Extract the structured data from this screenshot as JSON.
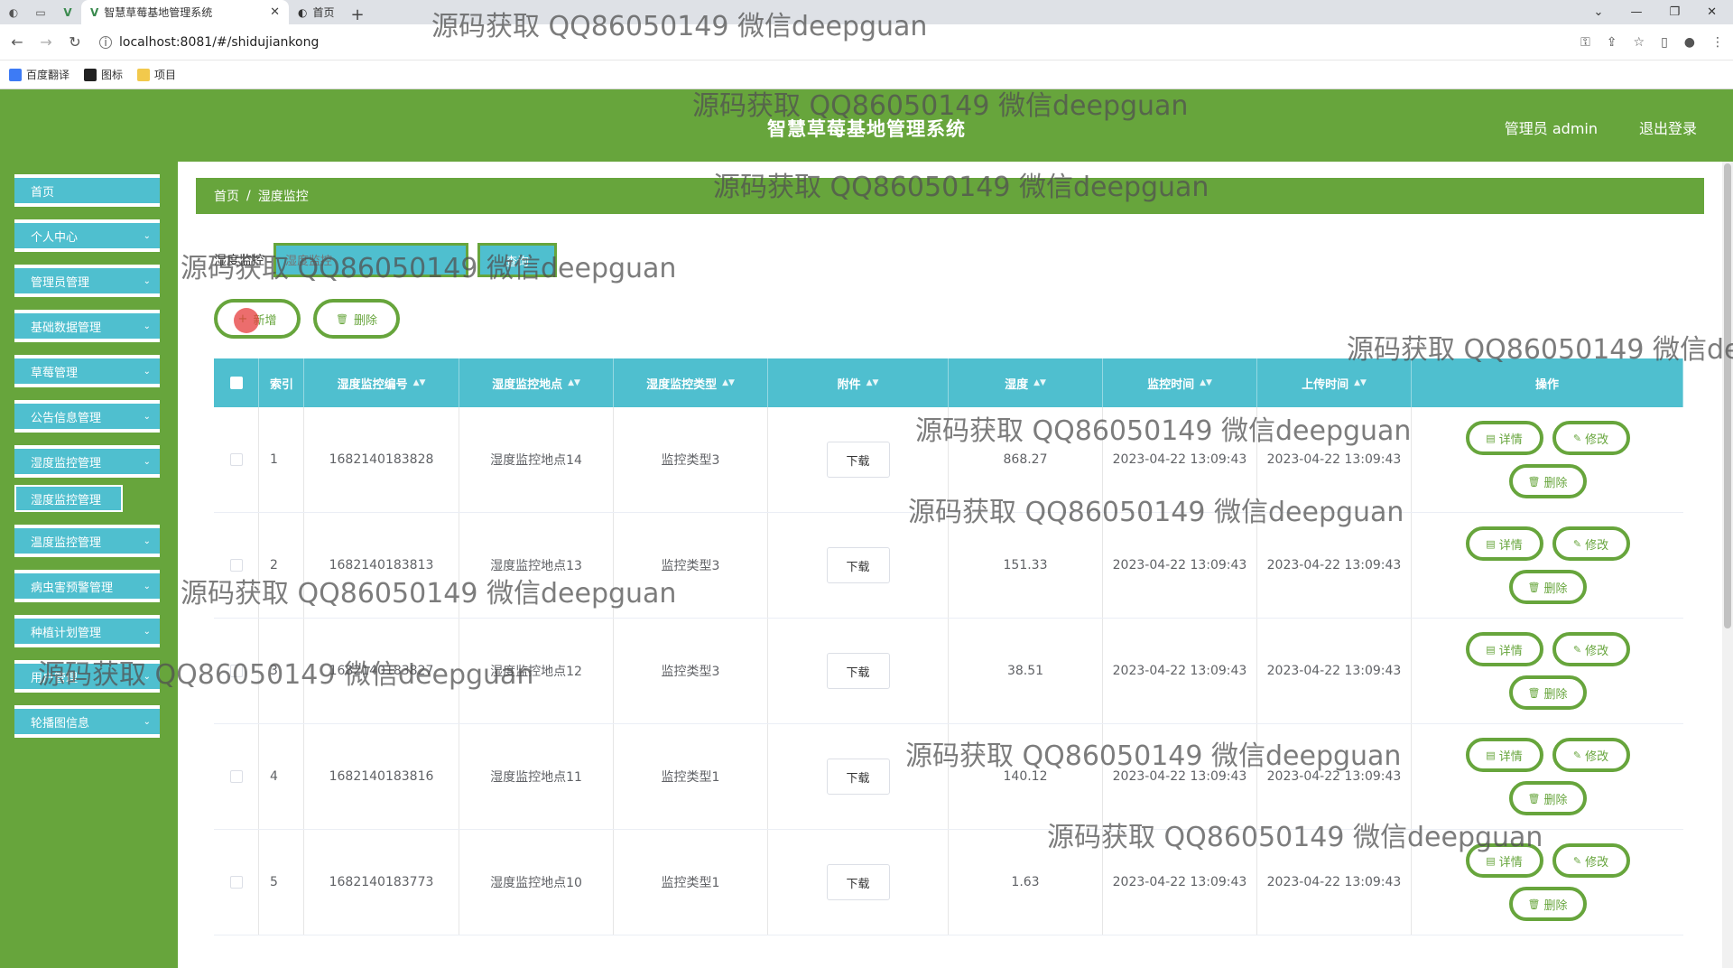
{
  "browser": {
    "active_tab_title": "智慧草莓基地管理系统",
    "second_tab_title": "首页",
    "url": "localhost:8081/#/shidujiankong",
    "bookmarks": [
      "百度翻译",
      "图标",
      "项目"
    ]
  },
  "app": {
    "title": "智慧草莓基地管理系统",
    "user_label": "管理员 admin",
    "logout_label": "退出登录"
  },
  "sidebar": {
    "items": [
      {
        "label": "首页"
      },
      {
        "label": "个人中心"
      },
      {
        "label": "管理员管理"
      },
      {
        "label": "基础数据管理"
      },
      {
        "label": "草莓管理"
      },
      {
        "label": "公告信息管理"
      },
      {
        "label": "湿度监控管理"
      },
      {
        "label": "温度监控管理"
      },
      {
        "label": "病虫害预警管理"
      },
      {
        "label": "种植计划管理"
      },
      {
        "label": "用户管理"
      },
      {
        "label": "轮播图信息"
      }
    ],
    "subitem": "湿度监控管理"
  },
  "breadcrumb": {
    "home": "首页",
    "separator": "/",
    "current": "湿度监控"
  },
  "search": {
    "label": "湿度监控",
    "placeholder": "湿度监控",
    "button_label": "查询"
  },
  "actions": {
    "add_label": "新增",
    "delete_label": "删除"
  },
  "table": {
    "headers": {
      "index": "索引",
      "code": "湿度监控编号",
      "place": "湿度监控地点",
      "type": "湿度监控类型",
      "file": "附件",
      "humidity": "湿度",
      "monitor_time": "监控时间",
      "upload_time": "上传时间",
      "ops": "操作"
    },
    "download_label": "下载",
    "op_detail": "详情",
    "op_edit": "修改",
    "op_delete": "删除",
    "rows": [
      {
        "index": "1",
        "code": "1682140183828",
        "place": "湿度监控地点14",
        "type": "监控类型3",
        "humidity": "868.27",
        "monitor_time": "2023-04-22 13:09:43",
        "upload_time": "2023-04-22 13:09:43"
      },
      {
        "index": "2",
        "code": "1682140183813",
        "place": "湿度监控地点13",
        "type": "监控类型3",
        "humidity": "151.33",
        "monitor_time": "2023-04-22 13:09:43",
        "upload_time": "2023-04-22 13:09:43"
      },
      {
        "index": "3",
        "code": "1682140183827",
        "place": "湿度监控地点12",
        "type": "监控类型3",
        "humidity": "38.51",
        "monitor_time": "2023-04-22 13:09:43",
        "upload_time": "2023-04-22 13:09:43"
      },
      {
        "index": "4",
        "code": "1682140183816",
        "place": "湿度监控地点11",
        "type": "监控类型1",
        "humidity": "140.12",
        "monitor_time": "2023-04-22 13:09:43",
        "upload_time": "2023-04-22 13:09:43"
      },
      {
        "index": "5",
        "code": "1682140183773",
        "place": "湿度监控地点10",
        "type": "监控类型1",
        "humidity": "1.63",
        "monitor_time": "2023-04-22 13:09:43",
        "upload_time": "2023-04-22 13:09:43"
      }
    ]
  },
  "watermark": "源码获取 QQ86050149 微信deepguan"
}
